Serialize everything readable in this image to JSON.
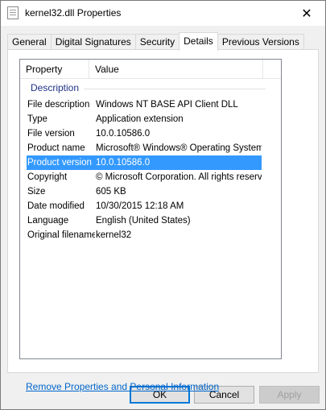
{
  "window": {
    "title": "kernel32.dll Properties",
    "close_glyph": "✕",
    "icon": "document-icon"
  },
  "tabs": [
    {
      "label": "General"
    },
    {
      "label": "Digital Signatures"
    },
    {
      "label": "Security"
    },
    {
      "label": "Details",
      "active": true
    },
    {
      "label": "Previous Versions"
    }
  ],
  "details": {
    "columns": {
      "property": "Property",
      "value": "Value"
    },
    "group_label": "Description",
    "rows": [
      {
        "property": "File description",
        "value": "Windows NT BASE API Client DLL"
      },
      {
        "property": "Type",
        "value": "Application extension"
      },
      {
        "property": "File version",
        "value": "10.0.10586.0"
      },
      {
        "property": "Product name",
        "value": "Microsoft® Windows® Operating System"
      },
      {
        "property": "Product version",
        "value": "10.0.10586.0",
        "selected": true
      },
      {
        "property": "Copyright",
        "value": "© Microsoft Corporation. All rights reserv..."
      },
      {
        "property": "Size",
        "value": "605 KB"
      },
      {
        "property": "Date modified",
        "value": "10/30/2015 12:18 AM"
      },
      {
        "property": "Language",
        "value": "English (United States)"
      },
      {
        "property": "Original filename",
        "value": "kernel32"
      }
    ]
  },
  "remove_link": "Remove Properties and Personal Information",
  "buttons": {
    "ok": "OK",
    "cancel": "Cancel",
    "apply": "Apply"
  },
  "colors": {
    "selection": "#3399ff",
    "group_text": "#1e3287",
    "link": "#0066cc",
    "default_button_border": "#0078d7"
  }
}
